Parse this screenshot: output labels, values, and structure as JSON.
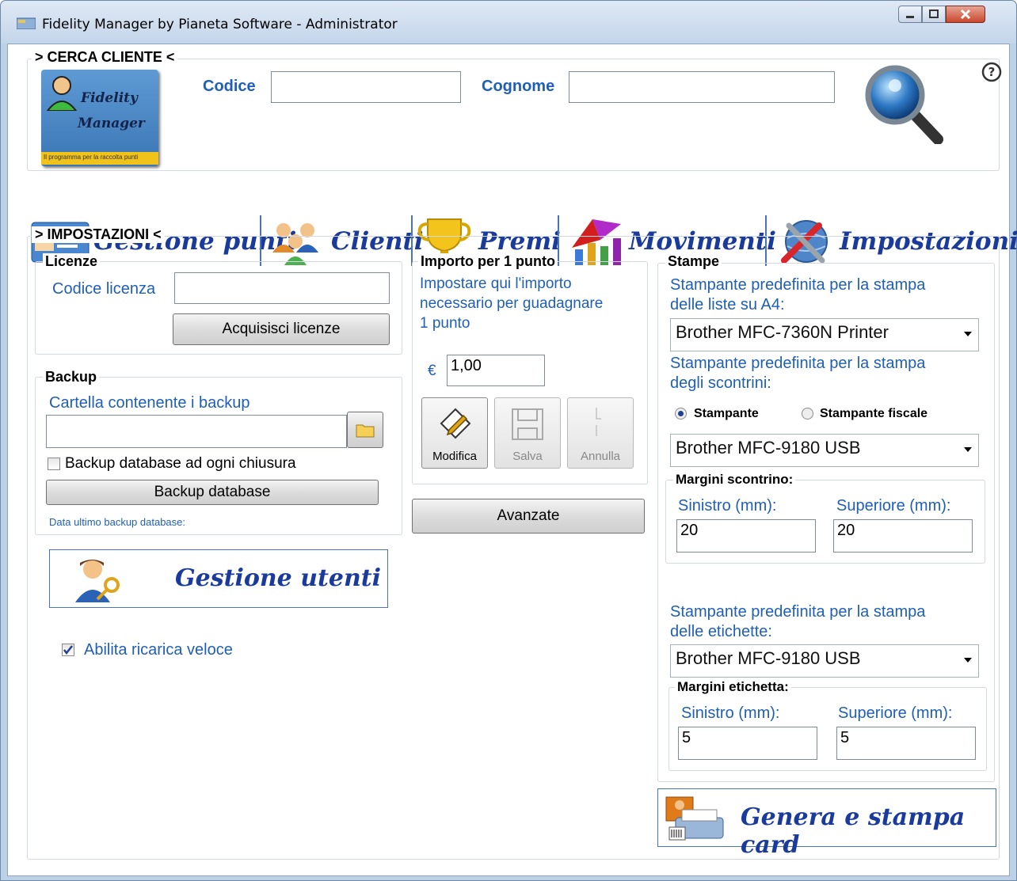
{
  "window": {
    "title": "Fidelity Manager by Pianeta Software - Administrator"
  },
  "search": {
    "legend": "> CERCA CLIENTE <",
    "codice_label": "Codice",
    "codice_value": "",
    "cognome_label": "Cognome",
    "cognome_value": "",
    "logo_line1": "Fidelity",
    "logo_line2": "Manager",
    "logo_tagline": "Il programma per la raccolta punti"
  },
  "nav": {
    "items": [
      {
        "label": "Gestione punti",
        "icon": "id-card-icon"
      },
      {
        "label": "Clienti",
        "icon": "people-icon"
      },
      {
        "label": "Premi",
        "icon": "trophy-icon"
      },
      {
        "label": "Movimenti",
        "icon": "chart-icon"
      },
      {
        "label": "Impostazioni",
        "icon": "tools-globe-icon"
      }
    ]
  },
  "settings": {
    "legend": "> IMPOSTAZIONI <",
    "licenze": {
      "title": "Licenze",
      "codice_label": "Codice licenza",
      "codice_value": "",
      "button": "Acquisisci licenze"
    },
    "backup": {
      "title": "Backup",
      "folder_label": "Cartella contenente i backup",
      "folder_value": "",
      "auto_label": "Backup database ad ogni chiusura",
      "auto_checked": false,
      "button": "Backup database",
      "last_label": "Data ultimo backup database:"
    },
    "utenti_button": "Gestione utenti",
    "ricarica_label": "Abilita ricarica veloce",
    "ricarica_checked": true,
    "importo": {
      "title": "Importo per 1 punto",
      "desc_line1": "Impostare qui l'importo",
      "desc_line2": "necessario per guadagnare",
      "desc_line3": "1 punto",
      "currency": "€",
      "value": "1,00",
      "modifica": "Modifica",
      "salva": "Salva",
      "annulla": "Annulla"
    },
    "avanzate_button": "Avanzate",
    "stampe": {
      "title": "Stampe",
      "a4_label_line1": "Stampante predefinita per la stampa",
      "a4_label_line2": "delle liste su A4:",
      "a4_printer": "Brother MFC-7360N Printer",
      "scontrini_label_line1": "Stampante predefinita per la stampa",
      "scontrini_label_line2": "degli scontrini:",
      "radio_stampante": "Stampante",
      "radio_fiscale": "Stampante fiscale",
      "scontrini_printer": "Brother MFC-9180 USB",
      "margini_scontrino_title": "Margini scontrino:",
      "sinistro_label": "Sinistro (mm):",
      "superiore_label": "Superiore (mm):",
      "scontrino_sinistro": "20",
      "scontrino_superiore": "20",
      "etichette_label_line1": "Stampante predefinita per la stampa",
      "etichette_label_line2": "delle etichette:",
      "etichette_printer": "Brother MFC-9180 USB",
      "margini_etichetta_title": "Margini etichetta:",
      "etichetta_sinistro": "5",
      "etichetta_superiore": "5"
    },
    "card_button": "Genera e stampa card"
  },
  "colors": {
    "label_blue": "#1f5fb5",
    "nav_text": "#1a3b9c"
  }
}
